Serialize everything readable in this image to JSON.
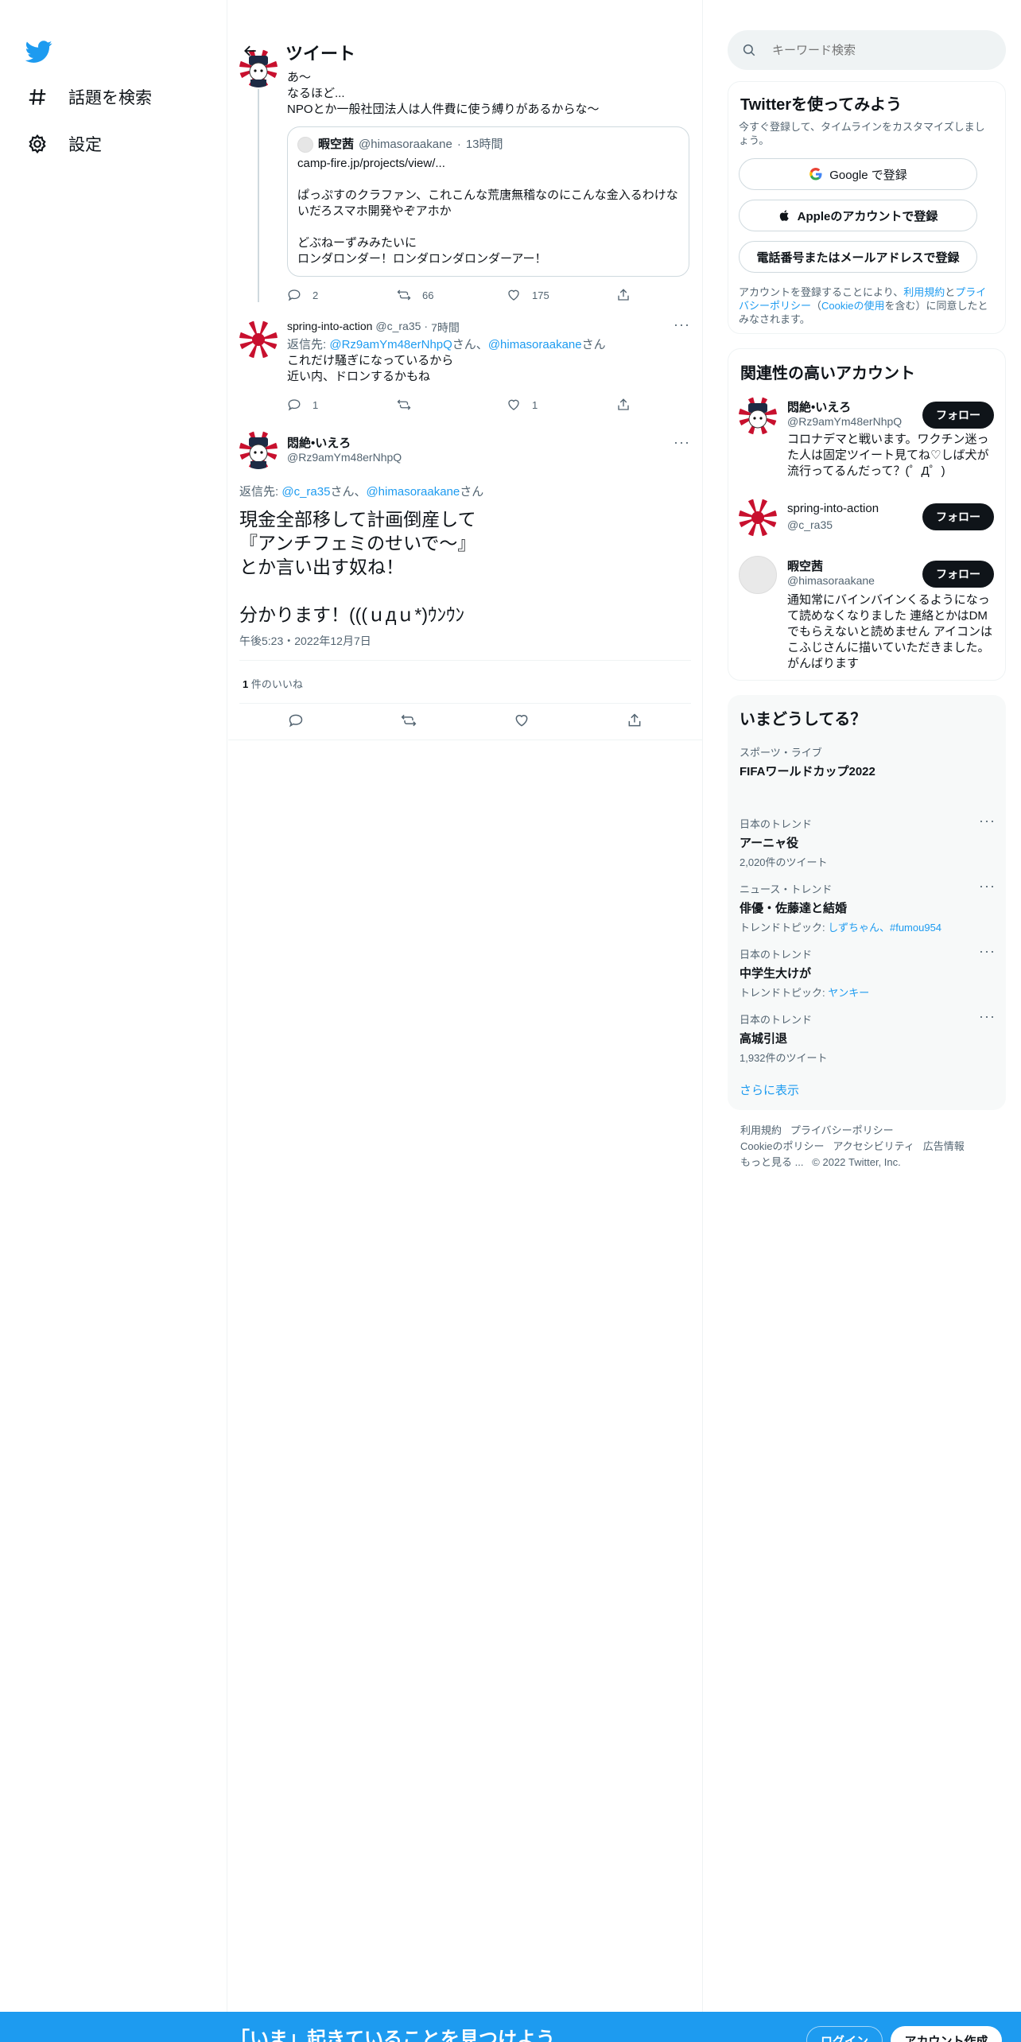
{
  "nav": {
    "logo": "twitter-bird-icon",
    "items": [
      {
        "label": "話題を検索",
        "icon": "hashtag-icon"
      },
      {
        "label": "設定",
        "icon": "gear-icon"
      }
    ]
  },
  "header": {
    "title": "ツイート"
  },
  "parent_tweet": {
    "lines": [
      "あ〜",
      "なるほど...",
      "NPOとか一般社団法人は人件費に使う縛りがあるからな〜"
    ],
    "quote": {
      "name": "暇空茜",
      "handle": "@himasoraakane",
      "time": "13時間",
      "link": "camp-fire.jp/projects/view/...",
      "line1": "ぱっぷすのクラファン、これこんな荒唐無稽なのにこんな金入るわけな",
      "line2": "いだろスマホ開発やぞアホか",
      "line3": "どぶねーずみみたいに",
      "line4": "ロンダロンダー！ロンダロンダロンダーアー！"
    },
    "stats": {
      "replies": "2",
      "retweets": "66",
      "likes": "175"
    }
  },
  "reply_tweet": {
    "name": "spring-into-action",
    "handle": "@c_ra35",
    "time": "7時間",
    "reply_prefix": "返信先: ",
    "reply_to1": "@Rz9amYm48erNhpQ",
    "reply_sep": "さん、",
    "reply_to2": "@himasoraakane",
    "reply_suffix": "さん",
    "lines": [
      "これだけ騒ぎになっているから",
      "近い内、ドロンするかもね"
    ],
    "stats": {
      "replies": "1",
      "likes": "1"
    }
  },
  "main_tweet": {
    "name": "悶絶•いえろ",
    "handle": "@Rz9amYm48erNhpQ",
    "reply_prefix": "返信先: ",
    "reply_to1": "@c_ra35",
    "reply_sep": "さん、",
    "reply_to2": "@himasoraakane",
    "reply_suffix": "さん",
    "lines": [
      "現金全部移して計画倒産して",
      "『アンチフェミのせいで〜』",
      "とか言い出す奴ね！",
      "",
      "分かります！(((ｕдｕ*)ｳﾝｳﾝ"
    ],
    "timestamp": "午後5:23・2022年12月7日",
    "likes_count": "1",
    "likes_label": " 件のいいね"
  },
  "search": {
    "placeholder": "キーワード検索"
  },
  "signup": {
    "title": "Twitterを使ってみよう",
    "desc": "今すぐ登録して、タイムラインをカスタマイズしましょう。",
    "google": "Google で登録",
    "apple": "Appleのアカウントで登録",
    "phone": "電話番号またはメールアドレスで登録",
    "terms_a": "アカウントを登録することにより、",
    "terms_link1": "利用規約",
    "terms_b": "と",
    "terms_link2": "プライバシーポリシー",
    "terms_c": "（",
    "terms_link3": "Cookieの使用",
    "terms_d": "を含む）に同意したとみなされます。"
  },
  "related": {
    "title": "関連性の高いアカウント",
    "follow_label": "フォロー",
    "accounts": [
      {
        "name": "悶絶•いえろ",
        "handle": "@Rz9amYm48erNhpQ",
        "bio": "コロナデマと戦います。ワクチン迷った人は固定ツイート見てね♡しば犬が流行ってるんだって？(゜Д゜)"
      },
      {
        "name": "spring-into-action",
        "handle": "@c_ra35",
        "bio": ""
      },
      {
        "name": "暇空茜",
        "handle": "@himasoraakane",
        "bio": "通知常にバインバインくるようになって読めなくなりました 連絡とかはDMでもらえないと読めません アイコンはこふじさんに描いていただきました。 がんばります"
      }
    ]
  },
  "trends": {
    "title": "いまどうしてる？",
    "items": [
      {
        "category": "スポーツ・ライブ",
        "name": "FIFAワールドカップ2022",
        "sub": ""
      },
      {
        "category": "日本のトレンド",
        "name": "アーニャ役",
        "sub": "2,020件のツイート"
      },
      {
        "category": "ニュース・トレンド",
        "name": "俳優・佐藤達と結婚",
        "sub_prefix": "トレンドトピック: ",
        "sub_links": "しずちゃん、#fumou954"
      },
      {
        "category": "日本のトレンド",
        "name": "中学生大けが",
        "sub_prefix": "トレンドトピック: ",
        "sub_links": "ヤンキー"
      },
      {
        "category": "日本のトレンド",
        "name": "高城引退",
        "sub": "1,932件のツイート"
      }
    ],
    "more": "さらに表示"
  },
  "footer": {
    "links1": [
      "利用規約",
      "プライバシーポリシー"
    ],
    "links2": [
      "Cookieのポリシー",
      "アクセシビリティ",
      "広告情報"
    ],
    "more": "もっと見る ...",
    "copyright": "© 2022 Twitter, Inc."
  },
  "bottom_bar": {
    "title": "「いま」起きていることを見つけよう",
    "login": "ログイン",
    "signup": "アカウント作成"
  },
  "colors": {
    "accent": "#1d9bf0",
    "text": "#0f1419",
    "muted": "#536471",
    "border": "#eff3f4"
  }
}
